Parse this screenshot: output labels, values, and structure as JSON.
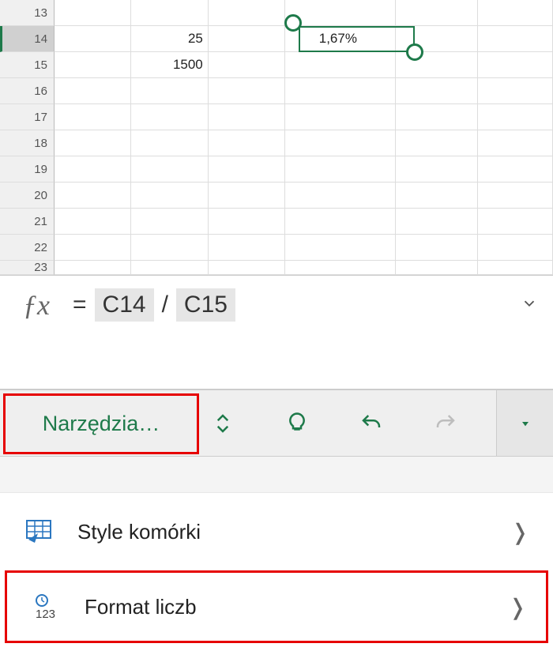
{
  "rows": {
    "r13": "13",
    "r14": "14",
    "r15": "15",
    "r16": "16",
    "r17": "17",
    "r18": "18",
    "r19": "19",
    "r20": "20",
    "r21": "21",
    "r22": "22",
    "r23": "23"
  },
  "cells": {
    "C14": "25",
    "C15": "1500",
    "E14": "1,67%"
  },
  "formula": {
    "eq": " = ",
    "tok1": "C14",
    "slash": " / ",
    "tok2": "C15"
  },
  "toolbar": {
    "tools_label": "Narzędzia…"
  },
  "menu": {
    "styles_label": "Style komórki",
    "format_label": "Format liczb"
  }
}
